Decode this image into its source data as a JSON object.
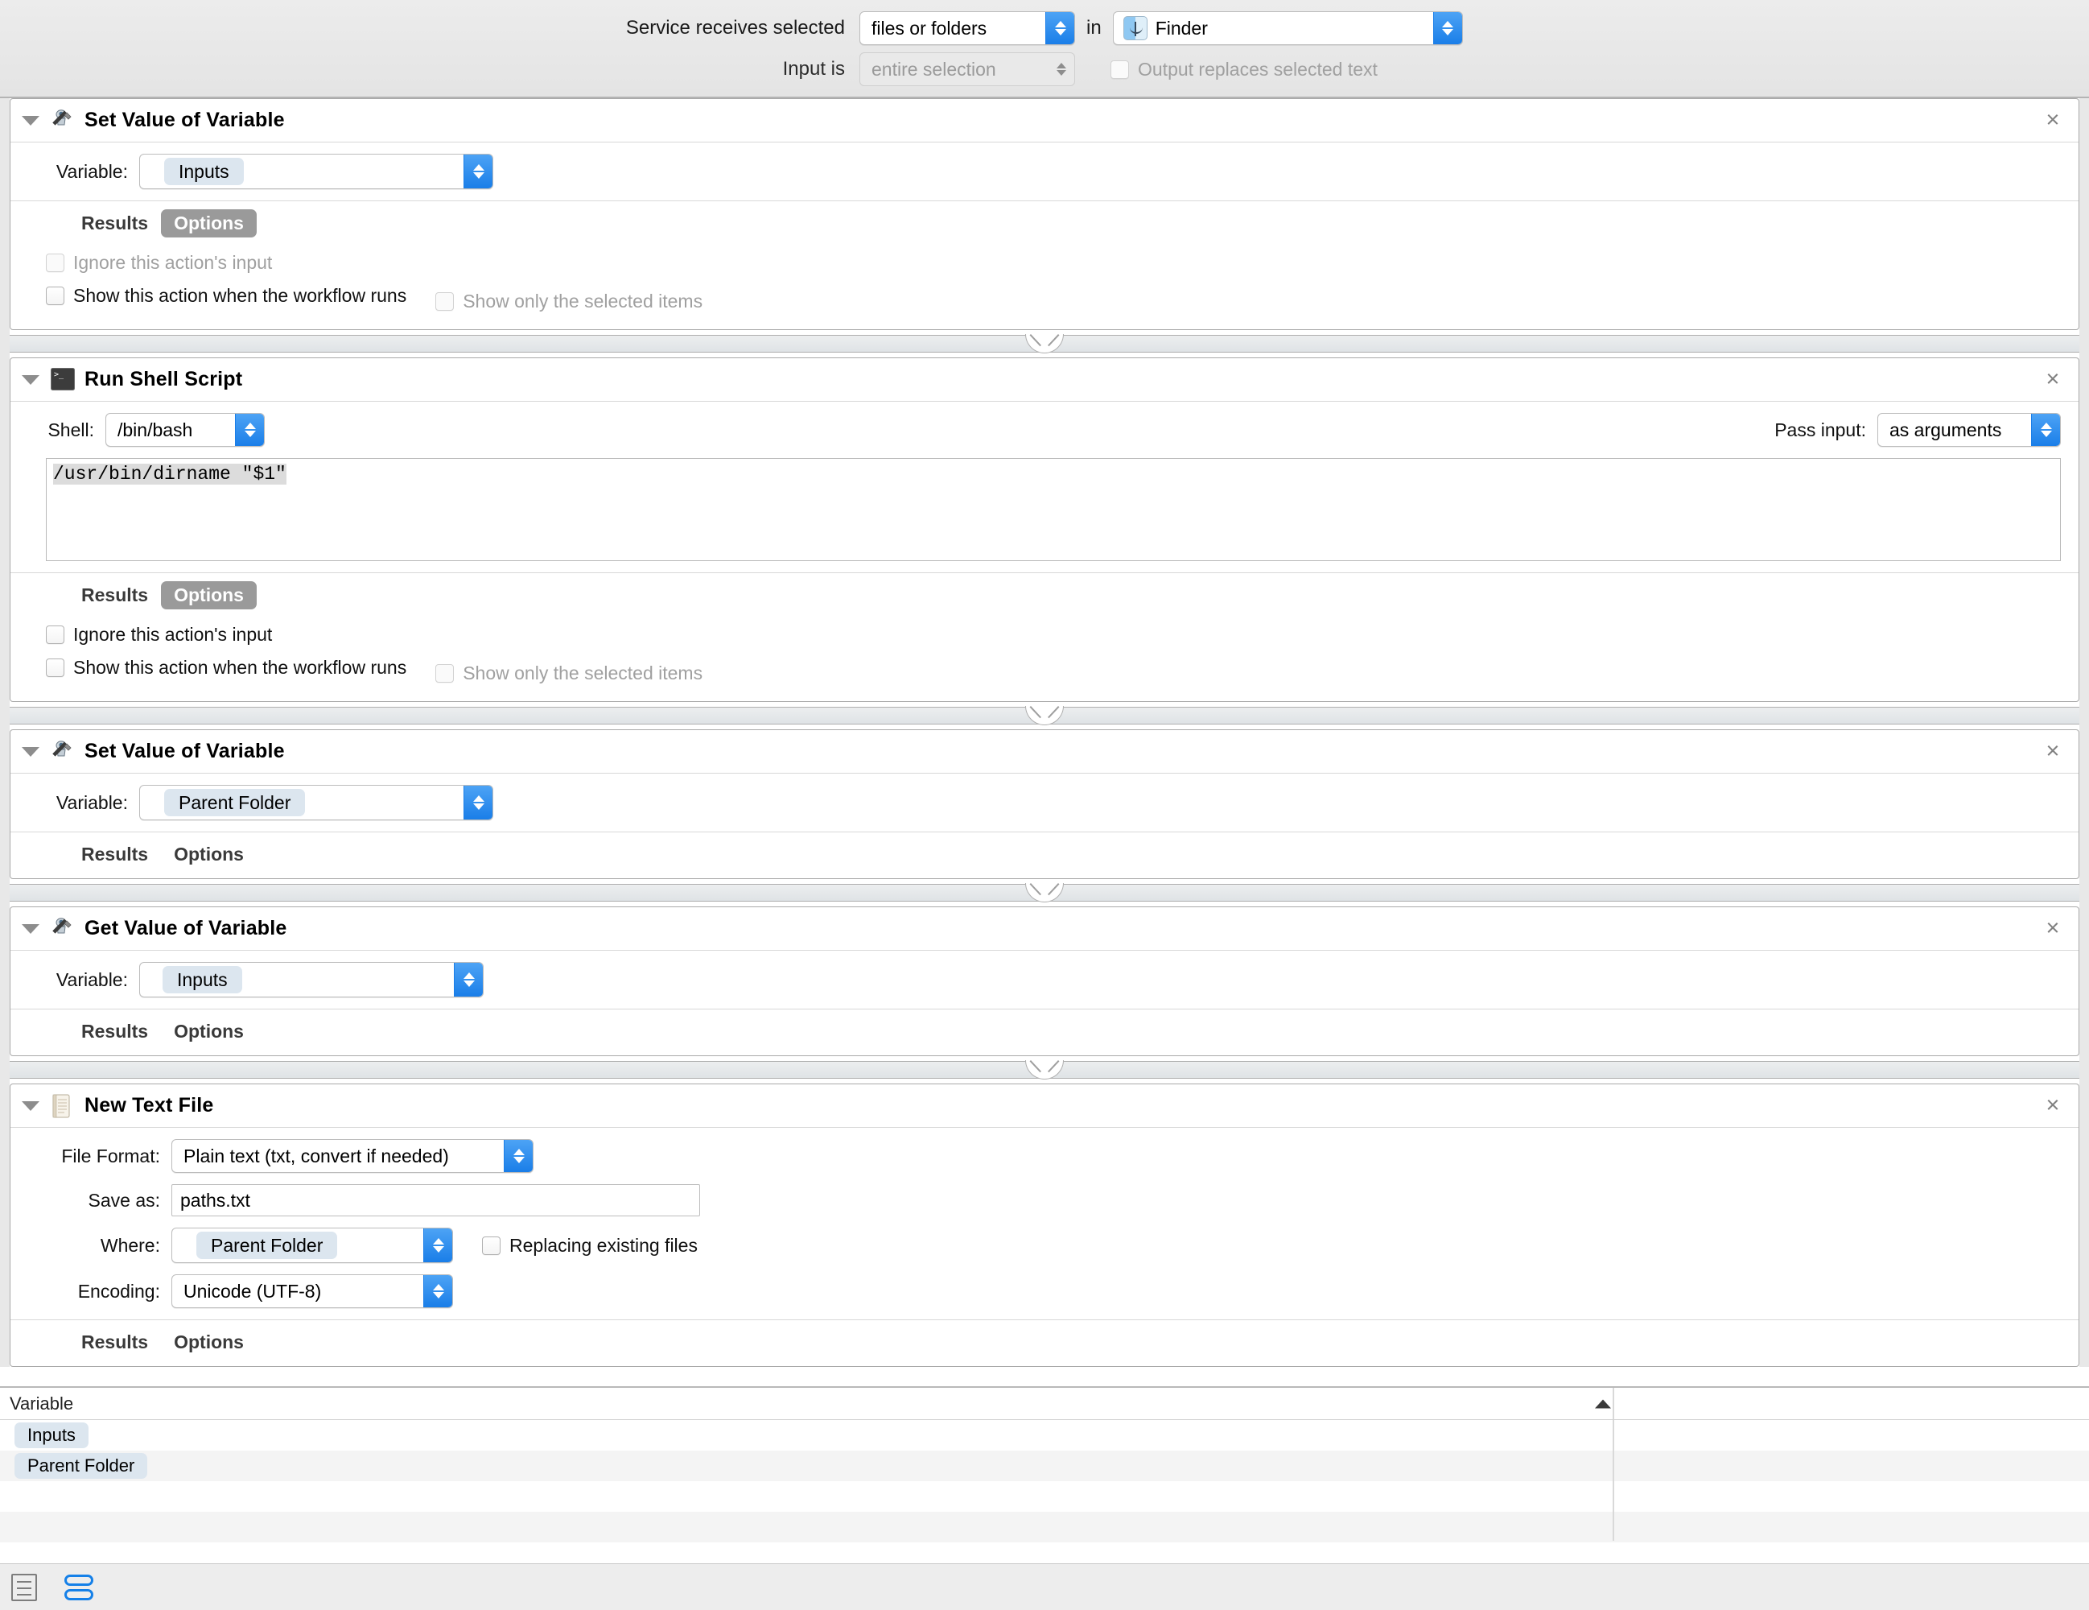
{
  "header": {
    "service_label": "Service receives selected",
    "service_value": "files or folders",
    "in_word": "in",
    "app_value": "Finder",
    "app_icon": "finder-icon",
    "input_label": "Input is",
    "input_value": "entire selection",
    "output_checkbox_label": "Output replaces selected text",
    "output_checked": false
  },
  "actions": [
    {
      "title": "Set Value of Variable",
      "icon": "automator-robot-variable-icon",
      "close_label": "×",
      "variable_label": "Variable:",
      "variable_value": "Inputs",
      "tabs": [
        {
          "label": "Results",
          "selected": false
        },
        {
          "label": "Options",
          "selected": true
        }
      ],
      "options": [
        {
          "label": "Ignore this action's input",
          "checked": false,
          "enabled": false
        },
        {
          "label": "Show this action when the workflow runs",
          "checked": false,
          "enabled": true
        },
        {
          "label": "Show only the selected items",
          "checked": false,
          "enabled": false
        }
      ]
    },
    {
      "title": "Run Shell Script",
      "icon": "terminal-icon",
      "close_label": "×",
      "shell_label": "Shell:",
      "shell_value": "/bin/bash",
      "pass_input_label": "Pass input:",
      "pass_input_value": "as arguments",
      "script": "/usr/bin/dirname \"$1\"",
      "tabs": [
        {
          "label": "Results",
          "selected": false
        },
        {
          "label": "Options",
          "selected": true
        }
      ],
      "options": [
        {
          "label": "Ignore this action's input",
          "checked": false,
          "enabled": true
        },
        {
          "label": "Show this action when the workflow runs",
          "checked": false,
          "enabled": true
        },
        {
          "label": "Show only the selected items",
          "checked": false,
          "enabled": false
        }
      ]
    },
    {
      "title": "Set Value of Variable",
      "icon": "automator-robot-variable-icon",
      "close_label": "×",
      "variable_label": "Variable:",
      "variable_value": "Parent Folder",
      "tabs": [
        {
          "label": "Results",
          "selected": false
        },
        {
          "label": "Options",
          "selected": false
        }
      ]
    },
    {
      "title": "Get Value of Variable",
      "icon": "automator-robot-variable-icon",
      "close_label": "×",
      "variable_label": "Variable:",
      "variable_value": "Inputs",
      "tabs": [
        {
          "label": "Results",
          "selected": false
        },
        {
          "label": "Options",
          "selected": false
        }
      ]
    },
    {
      "title": "New Text File",
      "icon": "text-file-icon",
      "close_label": "×",
      "file_format_label": "File Format:",
      "file_format_value": "Plain text (txt, convert if needed)",
      "save_as_label": "Save as:",
      "save_as_value": "paths.txt",
      "where_label": "Where:",
      "where_value": "Parent Folder",
      "replacing_label": "Replacing existing files",
      "replacing_checked": false,
      "encoding_label": "Encoding:",
      "encoding_value": "Unicode (UTF-8)",
      "tabs": [
        {
          "label": "Results",
          "selected": false
        },
        {
          "label": "Options",
          "selected": false
        }
      ]
    }
  ],
  "variables_panel": {
    "column_header": "Variable",
    "sort_icon": "chevron-up-icon",
    "rows": [
      {
        "name": "Inputs"
      },
      {
        "name": "Parent Folder"
      }
    ]
  },
  "bottom_toolbar": {
    "log_icon": "log-list-icon",
    "variables_icon": "variables-icon",
    "variables_active": true
  },
  "colors": {
    "accent_blue": "#1a7ee8",
    "pill_blue": "#dce6ef",
    "tab_selected_gray": "#9a9a9a",
    "panel_gray": "#ececec"
  }
}
